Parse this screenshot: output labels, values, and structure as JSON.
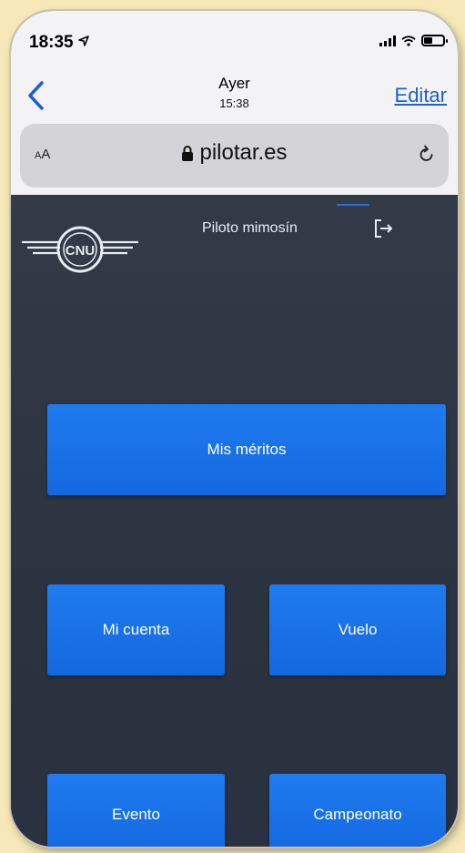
{
  "status_bar": {
    "time": "18:35"
  },
  "nav": {
    "title": "Ayer",
    "subtitle": "15:38",
    "edit_label": "Editar"
  },
  "address_bar": {
    "aa_label": "A",
    "aa_label2": "A",
    "url": "pilotar.es"
  },
  "site": {
    "user_name": "Piloto mimosín",
    "logo_text": "CNU",
    "buttons": {
      "merits": "Mis méritos",
      "account": "Mi cuenta",
      "flight": "Vuelo",
      "event": "Evento",
      "championship": "Campeonato"
    }
  },
  "colors": {
    "accent_blue": "#1c5fd6",
    "button_blue": "#1a72e8",
    "content_bg": "#2e3744",
    "page_bg": "#f6e8b8"
  }
}
